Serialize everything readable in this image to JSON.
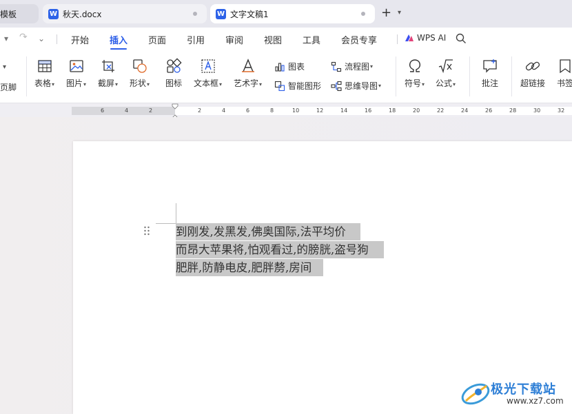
{
  "tabs": {
    "templates": "模板",
    "doc1": "秋天.docx",
    "doc2": "文字文稿1",
    "doc_icon_letter": "W",
    "new_tab": "+",
    "new_tab_menu": "⌄"
  },
  "menu": {
    "items": [
      "开始",
      "插入",
      "页面",
      "引用",
      "审阅",
      "视图",
      "工具",
      "会员专享"
    ],
    "active_index": 1,
    "wps_ai": "WPS AI"
  },
  "ribbon": {
    "footer": "页脚",
    "table": "表格",
    "picture": "图片",
    "screenshot": "截屏",
    "shapes": "形状",
    "icons": "图标",
    "textbox": "文本框",
    "wordart": "艺术字",
    "chart": "图表",
    "smart_graphic": "智能图形",
    "flowchart": "流程图",
    "mindmap": "思维导图",
    "symbol": "符号",
    "formula": "公式",
    "comment": "批注",
    "hyperlink": "超链接",
    "bookmark": "书签"
  },
  "ruler": {
    "left_ticks": [
      "6",
      "4",
      "2"
    ],
    "right_ticks": [
      "2",
      "4",
      "6",
      "8",
      "10",
      "12",
      "14",
      "16",
      "18",
      "20",
      "22",
      "24",
      "26",
      "28",
      "30",
      "32"
    ]
  },
  "document": {
    "lines": [
      "到刚发,发黑发,佛奥国际,法平均价",
      "而昂大苹果将,怕观看过,的膀胱,盗号狗",
      "肥胖,防静电皮,肥胖剺,房间"
    ]
  },
  "watermark": {
    "title": "极光下载站",
    "url": "www.xz7.com"
  },
  "colors": {
    "accent": "#2c5ee8",
    "selection": "#c8c8c8"
  }
}
